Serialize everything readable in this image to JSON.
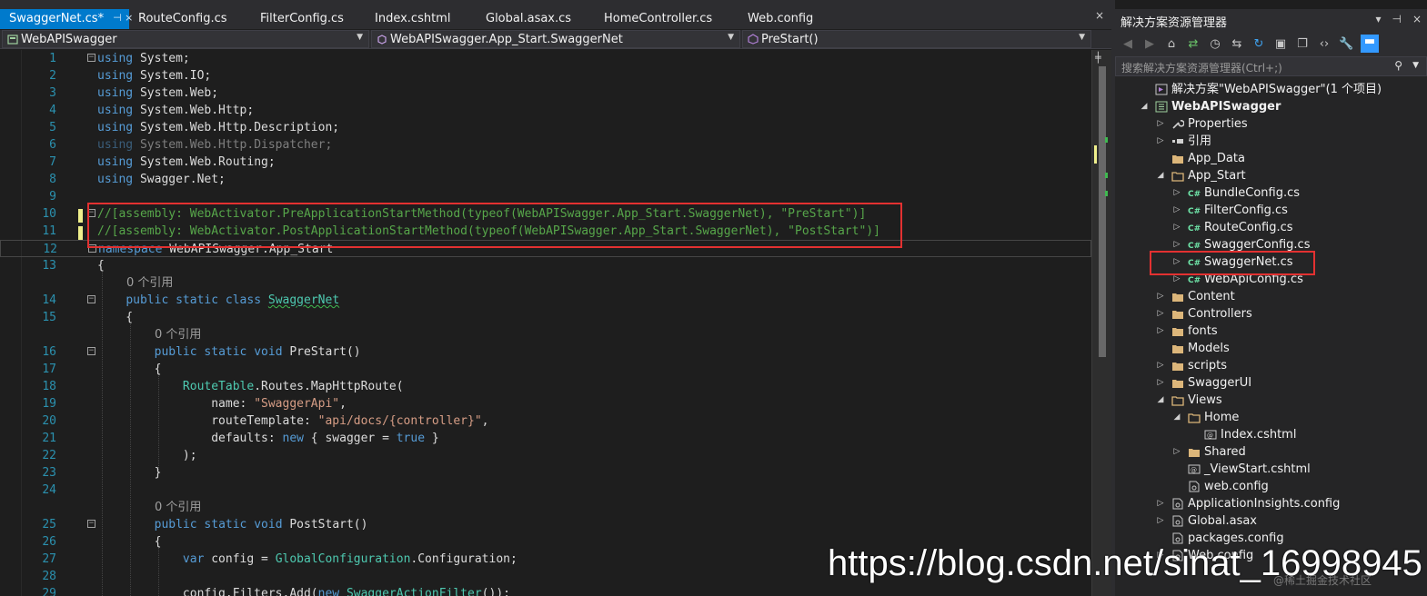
{
  "tabs": [
    {
      "label": "SwaggerNet.cs*",
      "pin": "⊣ ×",
      "active": true
    },
    {
      "label": "RouteConfig.cs"
    },
    {
      "label": "FilterConfig.cs"
    },
    {
      "label": "Index.cshtml"
    },
    {
      "label": "Global.asax.cs"
    },
    {
      "label": "HomeController.cs"
    },
    {
      "label": "Web.config"
    }
  ],
  "tab_close": "×",
  "navbar": {
    "project": "WebAPISwagger",
    "type": "WebAPISwagger.App_Start.SwaggerNet",
    "member": "PreStart()"
  },
  "code_lines": [
    {
      "n": "1",
      "fold": "−",
      "html": "<span class='kw'>using</span> System;"
    },
    {
      "n": "2",
      "html": "<span class='kw'>using</span> System.IO;"
    },
    {
      "n": "3",
      "html": "<span class='kw'>using</span> System.Web;"
    },
    {
      "n": "4",
      "html": "<span class='kw'>using</span> System.Web.Http;"
    },
    {
      "n": "5",
      "html": "<span class='kw'>using</span> System.Web.Http.Description;"
    },
    {
      "n": "6",
      "html": "<span class='dim'><span class='kw'>using</span> System.Web.Http.Dispatcher;</span>"
    },
    {
      "n": "7",
      "html": "<span class='kw'>using</span> System.Web.Routing;"
    },
    {
      "n": "8",
      "html": "<span class='kw'>using</span> Swagger.Net;"
    },
    {
      "n": "9",
      "html": ""
    },
    {
      "n": "10",
      "fold": "−",
      "changed": true,
      "html": "<span class='cm'>//[assembly: WebActivator.PreApplicationStartMethod(typeof(WebAPISwagger.App_Start.SwaggerNet), \"PreStart\")]</span>"
    },
    {
      "n": "11",
      "changed": true,
      "html": "<span class='cm'>//[assembly: WebActivator.PostApplicationStartMethod(typeof(WebAPISwagger.App_Start.SwaggerNet), \"PostStart\")]</span>"
    },
    {
      "n": "12",
      "fold": "−",
      "current": true,
      "html": "<span class='kw'>namespace</span> WebAPISwagger.App_Start"
    },
    {
      "n": "13",
      "html": "{"
    },
    {
      "n": "",
      "ref": "0 个引用",
      "indent": 1
    },
    {
      "n": "14",
      "fold": "−",
      "html": "    <span class='kw'>public</span> <span class='kw'>static</span> <span class='kw'>class</span> <span class='ty squig'>SwaggerNet</span>"
    },
    {
      "n": "15",
      "html": "    {"
    },
    {
      "n": "",
      "ref": "0 个引用",
      "indent": 2
    },
    {
      "n": "16",
      "fold": "−",
      "html": "        <span class='kw'>public</span> <span class='kw'>static</span> <span class='kw'>void</span> PreStart()"
    },
    {
      "n": "17",
      "html": "        {"
    },
    {
      "n": "18",
      "html": "            <span class='ty'>RouteTable</span>.Routes.MapHttpRoute("
    },
    {
      "n": "19",
      "html": "                name: <span class='str'>\"SwaggerApi\"</span>,"
    },
    {
      "n": "20",
      "html": "                routeTemplate: <span class='str'>\"api/docs/{controller}\"</span>,"
    },
    {
      "n": "21",
      "html": "                defaults: <span class='kw'>new</span> { swagger = <span class='kw'>true</span> }"
    },
    {
      "n": "22",
      "html": "            );"
    },
    {
      "n": "23",
      "html": "        }"
    },
    {
      "n": "24",
      "html": ""
    },
    {
      "n": "",
      "ref": "0 个引用",
      "indent": 2
    },
    {
      "n": "25",
      "fold": "−",
      "html": "        <span class='kw'>public</span> <span class='kw'>static</span> <span class='kw'>void</span> PostStart()"
    },
    {
      "n": "26",
      "html": "        {"
    },
    {
      "n": "27",
      "html": "            <span class='kw'>var</span> config = <span class='ty'>GlobalConfiguration</span>.Configuration;"
    },
    {
      "n": "28",
      "html": ""
    },
    {
      "n": "29",
      "html": "            config.Filters.Add(<span class='kw'>new</span> <span class='ty'>SwaggerActionFilter</span>());"
    }
  ],
  "solution_explorer": {
    "title": "解决方案资源管理器",
    "title_controls": [
      "▾",
      "⊣",
      "×"
    ],
    "search_placeholder": "搜索解决方案资源管理器(Ctrl+;)",
    "nodes": [
      {
        "label": "解决方案\"WebAPISwagger\"(1 个项目)",
        "depth": 0,
        "exp": "",
        "icon": "solution"
      },
      {
        "label": "WebAPISwagger",
        "depth": 0,
        "exp": "◢",
        "icon": "project",
        "bold": true
      },
      {
        "label": "Properties",
        "depth": 1,
        "exp": "▷",
        "icon": "wrench"
      },
      {
        "label": "引用",
        "depth": 1,
        "exp": "▷",
        "icon": "refs"
      },
      {
        "label": "App_Data",
        "depth": 1,
        "exp": "",
        "icon": "folder"
      },
      {
        "label": "App_Start",
        "depth": 1,
        "exp": "◢",
        "icon": "folder-open"
      },
      {
        "label": "BundleConfig.cs",
        "depth": 2,
        "exp": "▷",
        "icon": "cs"
      },
      {
        "label": "FilterConfig.cs",
        "depth": 2,
        "exp": "▷",
        "icon": "cs"
      },
      {
        "label": "RouteConfig.cs",
        "depth": 2,
        "exp": "▷",
        "icon": "cs"
      },
      {
        "label": "SwaggerConfig.cs",
        "depth": 2,
        "exp": "▷",
        "icon": "cs"
      },
      {
        "label": "SwaggerNet.cs",
        "depth": 2,
        "exp": "▷",
        "icon": "cs"
      },
      {
        "label": "WebApiConfig.cs",
        "depth": 2,
        "exp": "▷",
        "icon": "cs"
      },
      {
        "label": "Content",
        "depth": 1,
        "exp": "▷",
        "icon": "folder"
      },
      {
        "label": "Controllers",
        "depth": 1,
        "exp": "▷",
        "icon": "folder"
      },
      {
        "label": "fonts",
        "depth": 1,
        "exp": "▷",
        "icon": "folder"
      },
      {
        "label": "Models",
        "depth": 1,
        "exp": "",
        "icon": "folder"
      },
      {
        "label": "scripts",
        "depth": 1,
        "exp": "▷",
        "icon": "folder"
      },
      {
        "label": "SwaggerUI",
        "depth": 1,
        "exp": "▷",
        "icon": "folder"
      },
      {
        "label": "Views",
        "depth": 1,
        "exp": "◢",
        "icon": "folder-open"
      },
      {
        "label": "Home",
        "depth": 2,
        "exp": "◢",
        "icon": "folder-open"
      },
      {
        "label": "Index.cshtml",
        "depth": 3,
        "exp": "",
        "icon": "razor"
      },
      {
        "label": "Shared",
        "depth": 2,
        "exp": "▷",
        "icon": "folder"
      },
      {
        "label": "_ViewStart.cshtml",
        "depth": 2,
        "exp": "",
        "icon": "razor"
      },
      {
        "label": "web.config",
        "depth": 2,
        "exp": "",
        "icon": "config"
      },
      {
        "label": "ApplicationInsights.config",
        "depth": 1,
        "exp": "▷",
        "icon": "config"
      },
      {
        "label": "Global.asax",
        "depth": 1,
        "exp": "▷",
        "icon": "config"
      },
      {
        "label": "packages.config",
        "depth": 1,
        "exp": "",
        "icon": "config"
      },
      {
        "label": "Web.config",
        "depth": 1,
        "exp": "▷",
        "icon": "config"
      }
    ]
  },
  "watermark": "https://blog.csdn.net/sinat_16998945",
  "watermark_small": "@稀土掘金技术社区",
  "colors": {
    "accent": "#007acc",
    "highlight_box": "#e33131"
  }
}
